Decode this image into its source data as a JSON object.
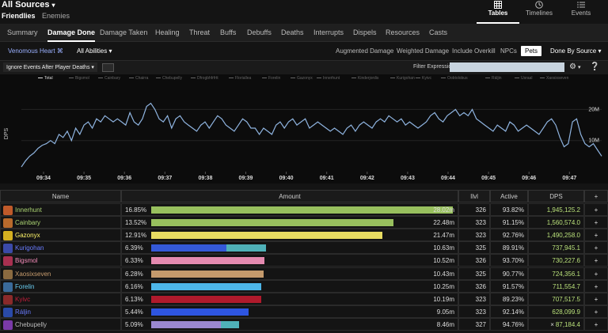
{
  "header": {
    "title": "All Sources",
    "subnav": {
      "friendlies": "Friendlies",
      "enemies": "Enemies"
    },
    "views": [
      {
        "label": "Tables",
        "icon": "table-icon"
      },
      {
        "label": "Timelines",
        "icon": "clock-icon"
      },
      {
        "label": "Events",
        "icon": "list-icon"
      }
    ]
  },
  "tabs": [
    "Summary",
    "Damage Done",
    "Damage Taken",
    "Healing",
    "Threat",
    "Buffs",
    "Debuffs",
    "Deaths",
    "Interrupts",
    "Dispels",
    "Resources",
    "Casts"
  ],
  "filters": {
    "source": "Venomous Heart ⌘",
    "abilities": "All Abilities",
    "options": [
      "Augmented Damage",
      "Weighted Damage",
      "Include Overkill",
      "NPCs",
      "Pets"
    ],
    "done_by": "Done By Source"
  },
  "chart_controls": {
    "ignore": "Ignore Events After Player Deaths",
    "filter_label": "Filter Expression:"
  },
  "chart_data": {
    "type": "line",
    "ylabel": "DPS",
    "ytick_labels": [
      "20M",
      "10M"
    ],
    "ytick_values": [
      20000000,
      10000000
    ],
    "ylim": [
      0,
      28000000
    ],
    "xtick_labels": [
      "09:34",
      "09:35",
      "09:36",
      "09:37",
      "09:38",
      "09:39",
      "09:40",
      "09:41",
      "09:42",
      "09:43",
      "09:44",
      "09:45",
      "09:46",
      "09:47"
    ],
    "legend": [
      "Total",
      "Bigsmol",
      "Cainbary",
      "Chairra",
      "Chebupelly",
      "Dfrogbhfrfrtt",
      "Floriallea",
      "Forelin",
      "Gazonyx",
      "Innerhunt",
      "Kinderjordis",
      "Kurigohan",
      "Kyivc",
      "Oobtolobus",
      "Ráljin",
      "Usraal",
      "Xaosixseven"
    ],
    "series": [
      {
        "name": "Total",
        "values": [
          1.5,
          3.5,
          5.0,
          6.0,
          7.5,
          8.5,
          9.0,
          10.0,
          9.0,
          12.0,
          11.0,
          13.0,
          10.0,
          14.0,
          12.0,
          15.0,
          16.0,
          14.0,
          17.0,
          16.0,
          18.0,
          17.0,
          16.0,
          17.0,
          16.0,
          15.0,
          19.0,
          16.0,
          15.0,
          17.0,
          21.0,
          22.0,
          20.0,
          17.0,
          16.0,
          18.0,
          14.0,
          17.0,
          18.0,
          16.0,
          15.0,
          14.0,
          13.0,
          15.0,
          16.0,
          14.0,
          16.0,
          18.0,
          17.0,
          15.0,
          14.0,
          13.0,
          15.0,
          17.0,
          16.0,
          14.0,
          14.0,
          12.0,
          14.0,
          13.0,
          12.0,
          15.0,
          16.0,
          14.0,
          16.0,
          17.0,
          15.0,
          16.0,
          17.0,
          14.0,
          15.0,
          16.0,
          15.0,
          14.0,
          13.0,
          14.0,
          13.0,
          12.0,
          14.0,
          15.0,
          13.0,
          15.0,
          16.0,
          15.0,
          14.0,
          16.0,
          17.0,
          16.0,
          18.0,
          17.0,
          16.0,
          17.0,
          15.0,
          16.0,
          15.0,
          14.0,
          15.0,
          16.0,
          18.0,
          19.0,
          17.0,
          16.0,
          18.0,
          19.0,
          20.0,
          18.0,
          19.0,
          18.0,
          20.0,
          17.0,
          16.0,
          15.0,
          14.0,
          13.0,
          15.0,
          14.0,
          13.0,
          16.0,
          15.0,
          13.0,
          14.0,
          15.0,
          14.0,
          13.0,
          12.0,
          14.0,
          16.0,
          17.0,
          15.0,
          11.0,
          8.0,
          9.0,
          16.0,
          17.0,
          12.0,
          9.0,
          8.0,
          9.0,
          7.0,
          5.0
        ]
      }
    ]
  },
  "table": {
    "headers": {
      "name": "Name",
      "amount": "Amount",
      "ilvl": "Ilvl",
      "active": "Active",
      "dps": "DPS",
      "plus": "+"
    },
    "rows": [
      {
        "name": "Innerhunt",
        "pct": "16.85%",
        "amount": "28.02m",
        "ilvl": "326",
        "active": "93.82%",
        "dps": "1,945,125.2",
        "plus": "+",
        "name_color": "#abd473",
        "bar_color": "#98c05e",
        "bar_frac": 1.0,
        "bar2_color": "",
        "bar2_frac": 0,
        "icon_color": "#c05a2a"
      },
      {
        "name": "Cainbary",
        "pct": "13.52%",
        "amount": "22.48m",
        "ilvl": "323",
        "active": "91.15%",
        "dps": "1,560,574.0",
        "plus": "+",
        "name_color": "#abd473",
        "bar_color": "#98c05e",
        "bar_frac": 0.802,
        "bar2_color": "",
        "bar2_frac": 0,
        "icon_color": "#b86a2c"
      },
      {
        "name": "Gazonyx",
        "pct": "12.91%",
        "amount": "21.47m",
        "ilvl": "323",
        "active": "92.76%",
        "dps": "1,490,258.0",
        "plus": "+",
        "name_color": "#fff569",
        "bar_color": "#e8dc62",
        "bar_frac": 0.766,
        "bar2_color": "",
        "bar2_frac": 0,
        "icon_color": "#d4b020"
      },
      {
        "name": "Kurigohan",
        "pct": "6.39%",
        "amount": "10.63m",
        "ilvl": "325",
        "active": "89.91%",
        "dps": "737,945.1",
        "plus": "+",
        "name_color": "#6a7cff",
        "bar_color": "#3459d8",
        "bar_frac": 0.25,
        "bar2_color": "#4fb1b8",
        "bar2_frac": 0.13,
        "icon_color": "#3b4aa8"
      },
      {
        "name": "Bigsmol",
        "pct": "6.33%",
        "amount": "10.52m",
        "ilvl": "326",
        "active": "93.70%",
        "dps": "730,227.6",
        "plus": "+",
        "name_color": "#f58cba",
        "bar_color": "#e48ab0",
        "bar_frac": 0.375,
        "bar2_color": "",
        "bar2_frac": 0,
        "icon_color": "#a83050"
      },
      {
        "name": "Xaosixseven",
        "pct": "6.28%",
        "amount": "10.43m",
        "ilvl": "325",
        "active": "90.77%",
        "dps": "724,356.1",
        "plus": "+",
        "name_color": "#c79c6e",
        "bar_color": "#c49a6c",
        "bar_frac": 0.372,
        "bar2_color": "",
        "bar2_frac": 0,
        "icon_color": "#8a6a40"
      },
      {
        "name": "Forelin",
        "pct": "6.16%",
        "amount": "10.25m",
        "ilvl": "326",
        "active": "91.57%",
        "dps": "711,554.7",
        "plus": "+",
        "name_color": "#69ccf0",
        "bar_color": "#4db6e8",
        "bar_frac": 0.366,
        "bar2_color": "",
        "bar2_frac": 0,
        "icon_color": "#3a6a9a"
      },
      {
        "name": "Kyivc",
        "pct": "6.13%",
        "amount": "10.19m",
        "ilvl": "323",
        "active": "89.23%",
        "dps": "707,517.5",
        "plus": "+",
        "name_color": "#c41f3b",
        "bar_color": "#b01a2c",
        "bar_frac": 0.364,
        "bar2_color": "",
        "bar2_frac": 0,
        "icon_color": "#8a2a2a"
      },
      {
        "name": "Ráljin",
        "pct": "5.44%",
        "amount": "9.05m",
        "ilvl": "323",
        "active": "92.14%",
        "dps": "628,099.9",
        "plus": "+",
        "name_color": "#6a7cff",
        "bar_color": "#2e55e0",
        "bar_frac": 0.323,
        "bar2_color": "",
        "bar2_frac": 0,
        "icon_color": "#2a4aa8"
      },
      {
        "name": "Chebupelly",
        "pct": "5.09%",
        "amount": "8.46m",
        "ilvl": "327",
        "active": "94.76%",
        "dps": "87,184.4",
        "dps_prefix": "×",
        "plus": "+",
        "name_color": "#bbbbbb",
        "bar_color": "#9b88d0",
        "bar_frac": 0.232,
        "bar2_color": "#4fb1b8",
        "bar2_frac": 0.06,
        "icon_color": "#7a3aa8"
      }
    ]
  }
}
